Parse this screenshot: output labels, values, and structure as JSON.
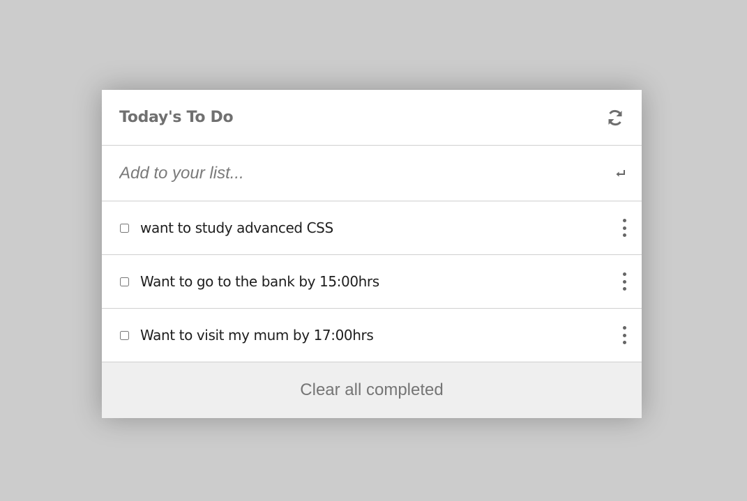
{
  "header": {
    "title": "Today's To Do",
    "refresh_icon": "refresh-icon"
  },
  "add": {
    "placeholder": "Add to your list...",
    "enter_icon": "enter-icon"
  },
  "todos": [
    {
      "text": "want to study advanced CSS",
      "checked": false
    },
    {
      "text": "Want to go to the bank by 15:00hrs",
      "checked": false
    },
    {
      "text": "Want to visit my mum by 17:00hrs",
      "checked": false
    }
  ],
  "footer": {
    "clear_label": "Clear all completed"
  },
  "colors": {
    "background": "#cccccc",
    "card": "#ffffff",
    "footer": "#efefef",
    "muted_text": "#707070"
  }
}
